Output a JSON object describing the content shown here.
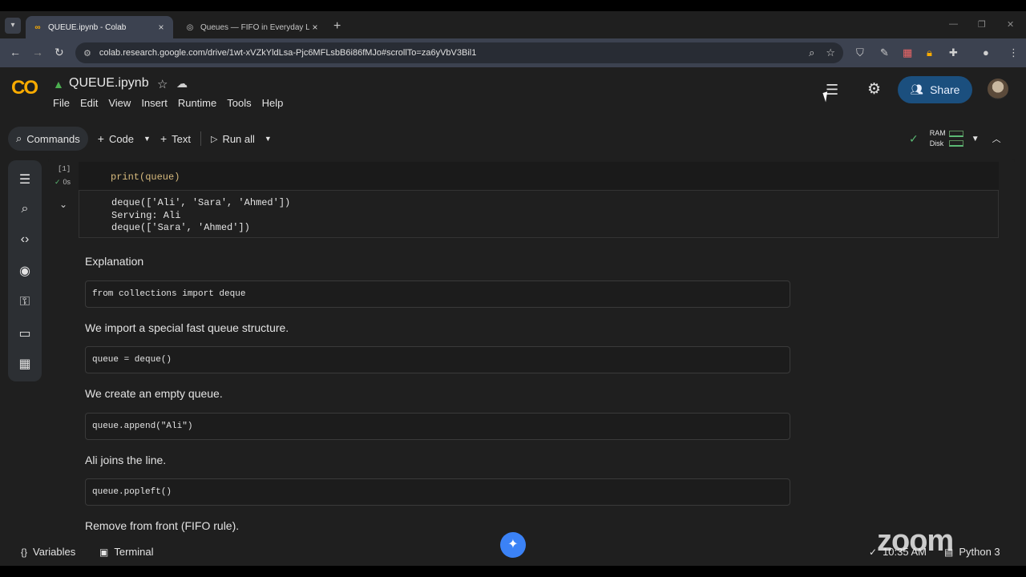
{
  "browser": {
    "tabs": [
      {
        "title": "QUEUE.ipynb - Colab",
        "icon": "colab-icon"
      },
      {
        "title": "Queues — FIFO in Everyday Life",
        "icon": "globe-icon"
      }
    ],
    "url": "colab.research.google.com/drive/1wt-xVZkYldLsa-Pjc6MFLsbB6i86fMJo#scrollTo=za6yVbV3Bil1"
  },
  "colab": {
    "logo": "CO",
    "file_name": "QUEUE.ipynb",
    "menu": [
      "File",
      "Edit",
      "View",
      "Insert",
      "Runtime",
      "Tools",
      "Help"
    ],
    "share_label": "Share",
    "toolbar": {
      "commands": "Commands",
      "code": "Code",
      "text": "Text",
      "run_all": "Run all"
    },
    "runtime": {
      "ram": "RAM",
      "disk": "Disk"
    }
  },
  "notebook": {
    "code_cell": {
      "exec_count": "[1]",
      "exec_time": "0s",
      "source": "print(queue)",
      "output": "deque(['Ali', 'Sara', 'Ahmed'])\nServing: Ali\ndeque(['Sara', 'Ahmed'])"
    },
    "explanation_heading": "Explanation",
    "steps": [
      {
        "code": "from collections import deque",
        "text": "We import a special fast queue structure."
      },
      {
        "code": "queue = deque()",
        "text": "We create an empty queue."
      },
      {
        "code": "queue.append(\"Ali\")",
        "text": "Ali joins the line."
      },
      {
        "code": "queue.popleft()",
        "text": "Remove from front (FIFO rule)."
      }
    ]
  },
  "statusbar": {
    "variables": "Variables",
    "terminal": "Terminal",
    "time": "10:35 AM",
    "kernel": "Python 3"
  },
  "overlay": {
    "watermark": "zoom"
  },
  "colors": {
    "accent": "#1b4f7e",
    "logo": "#f9ab00",
    "ok": "#5bb974"
  }
}
